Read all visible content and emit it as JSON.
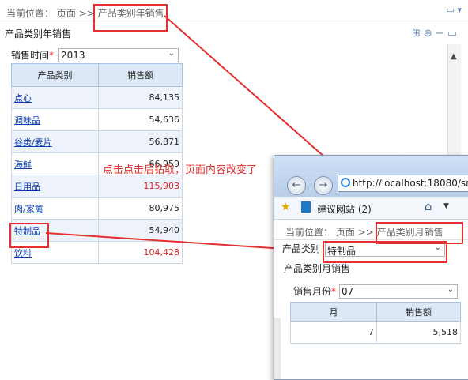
{
  "breadcrumb": {
    "prefix": "当前位置：",
    "page": "页面",
    "separator": ">>",
    "current": "产品类别年销售"
  },
  "panel": {
    "title": "产品类别年销售"
  },
  "filter": {
    "label": "销售时间",
    "required_mark": "*",
    "value": "2013"
  },
  "table": {
    "headers": [
      "产品类别",
      "销售额"
    ],
    "rows": [
      {
        "category": "点心",
        "amount": "84,135",
        "highlight": false
      },
      {
        "category": "调味品",
        "amount": "54,636",
        "highlight": false
      },
      {
        "category": "谷类/麦片",
        "amount": "56,871",
        "highlight": false
      },
      {
        "category": "海鲜",
        "amount": "66,959",
        "highlight": false
      },
      {
        "category": "日用品",
        "amount": "115,903",
        "highlight": true
      },
      {
        "category": "肉/家禽",
        "amount": "80,975",
        "highlight": false
      },
      {
        "category": "特制品",
        "amount": "54,940",
        "highlight": false
      },
      {
        "category": "饮料",
        "amount": "104,428",
        "highlight": true
      }
    ]
  },
  "annotation": {
    "text": "点击点击后钻取，页面内容改变了"
  },
  "popup": {
    "url": "http://localhost:18080/sm",
    "favorites": {
      "label": "建议网站 (2)"
    },
    "breadcrumb": {
      "prefix": "当前位置：",
      "page": "页面",
      "separator": ">>",
      "current": "产品类别月销售"
    },
    "category_select": {
      "label": "产品类别",
      "value": "特制品"
    },
    "panel_title": "产品类别月销售",
    "filter": {
      "label": "销售月份",
      "required_mark": "*",
      "value": "07"
    },
    "table": {
      "headers": [
        "月",
        "销售额"
      ],
      "rows": [
        {
          "month": "7",
          "amount": "5,518"
        }
      ]
    }
  },
  "colors": {
    "accent_red": "#e53030",
    "link_blue": "#0b3fb0",
    "header_bg": "#dce8f5"
  }
}
